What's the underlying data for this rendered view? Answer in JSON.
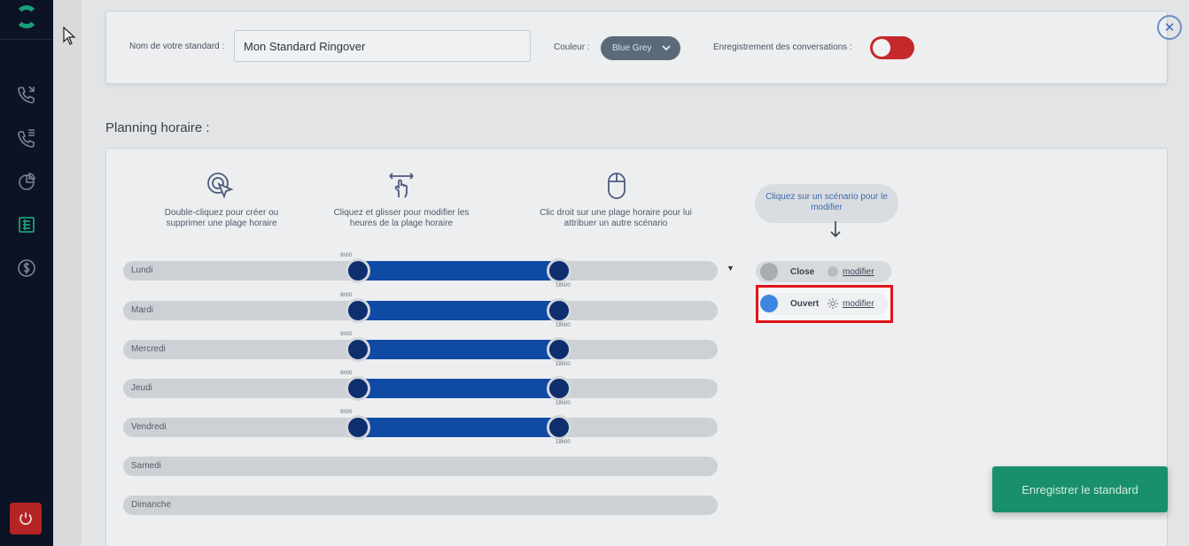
{
  "header": {
    "name_label": "Nom de votre standard :",
    "name_value": "Mon Standard Ringover",
    "color_label": "Couleur :",
    "color_value": "Blue Grey",
    "recording_label": "Enregistrement des conversations :",
    "recording_enabled": false,
    "close_icon": "close-icon"
  },
  "planning": {
    "title": "Planning horaire :",
    "hints": [
      {
        "icon": "double-click-icon",
        "text": "Double-cliquez pour créer ou supprimer une plage horaire"
      },
      {
        "icon": "drag-icon",
        "text": "Cliquez et glisser pour modifier les heures de la plage horaire"
      },
      {
        "icon": "mouse-icon",
        "text": "Clic droit sur une plage horaire pour lui attribuer un autre scénario"
      }
    ],
    "scenario_hint": "Cliquez sur un scénario pour le modifier",
    "days": [
      {
        "label": "Lundi",
        "start": "9h00",
        "end": "18h00",
        "has_range": true
      },
      {
        "label": "Mardi",
        "start": "9h00",
        "end": "18h00",
        "has_range": true
      },
      {
        "label": "Mercredi",
        "start": "9h00",
        "end": "18h00",
        "has_range": true
      },
      {
        "label": "Jeudi",
        "start": "9h00",
        "end": "18h00",
        "has_range": true
      },
      {
        "label": "Vendredi",
        "start": "9h00",
        "end": "18h00",
        "has_range": true
      },
      {
        "label": "Samedi",
        "has_range": false
      },
      {
        "label": "Dimanche",
        "has_range": false
      }
    ],
    "scenarios": [
      {
        "name": "Close",
        "link": "modifier",
        "color": "#a9adb2"
      },
      {
        "name": "Ouvert",
        "link": "modifier",
        "color": "#3f86e0"
      }
    ]
  },
  "save_button": "Enregistrer le standard",
  "colors": {
    "sidebar": "#0c1324",
    "accent_green": "#1a8f6b",
    "range_blue": "#0f4aa5",
    "toggle_red": "#c5292b",
    "highlight": "#e0141a"
  }
}
